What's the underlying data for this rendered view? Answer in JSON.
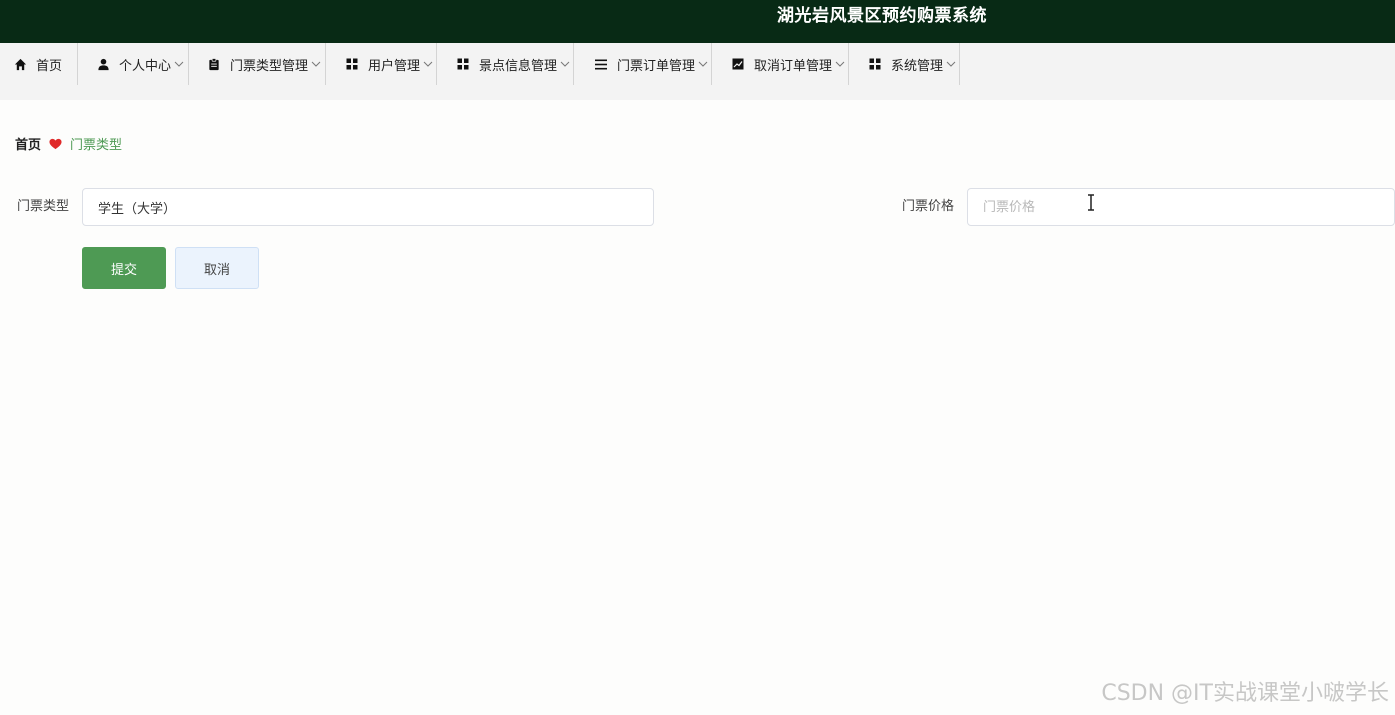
{
  "header": {
    "title": "湖光岩风景区预约购票系统"
  },
  "nav": {
    "items": [
      {
        "label": "首页",
        "icon": "home-icon",
        "dropdown": false
      },
      {
        "label": "个人中心",
        "icon": "user-icon",
        "dropdown": true
      },
      {
        "label": "门票类型管理",
        "icon": "clipboard-icon",
        "dropdown": true
      },
      {
        "label": "用户管理",
        "icon": "grid-icon",
        "dropdown": true
      },
      {
        "label": "景点信息管理",
        "icon": "grid-icon",
        "dropdown": true
      },
      {
        "label": "门票订单管理",
        "icon": "list-icon",
        "dropdown": true
      },
      {
        "label": "取消订单管理",
        "icon": "chart-icon",
        "dropdown": true
      },
      {
        "label": "系统管理",
        "icon": "grid-icon",
        "dropdown": true
      }
    ]
  },
  "breadcrumb": {
    "home": "首页",
    "current": "门票类型",
    "separator_icon": "heart-icon"
  },
  "form": {
    "ticket_type": {
      "label": "门票类型",
      "value": "学生（大学）"
    },
    "ticket_price": {
      "label": "门票价格",
      "placeholder": "门票价格",
      "value": ""
    },
    "submit_label": "提交",
    "cancel_label": "取消"
  },
  "watermark": "CSDN @IT实战课堂小啵学长",
  "colors": {
    "header_bg": "#082a15",
    "nav_bg": "#f3f3f3",
    "accent_green": "#4e9a54",
    "heart_red": "#e02a2a",
    "cancel_bg": "#ebf3fd"
  }
}
